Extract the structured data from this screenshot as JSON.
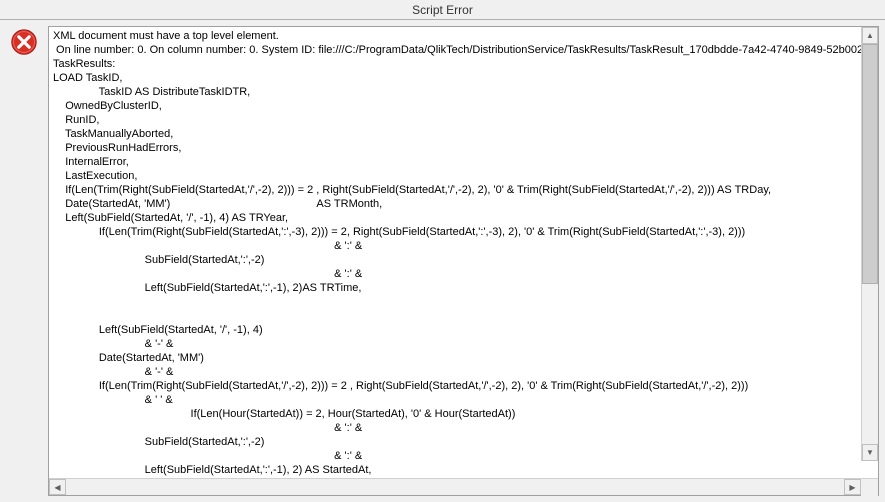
{
  "window": {
    "title": "Script Error"
  },
  "error": {
    "text": "XML document must have a top level element.\n On line number: 0. On column number: 0. System ID: file:///C:/ProgramData/QlikTech/DistributionService/TaskResults/TaskResult_170dbdde-7a42-4740-9849-52b002\nTaskResults:\nLOAD TaskID,\n               TaskID AS DistributeTaskIDTR,\n    OwnedByClusterID,\n    RunID,\n    TaskManuallyAborted,\n    PreviousRunHadErrors,\n    InternalError,\n    LastExecution,\n    If(Len(Trim(Right(SubField(StartedAt,'/',-2), 2))) = 2 , Right(SubField(StartedAt,'/',-2), 2), '0' & Trim(Right(SubField(StartedAt,'/',-2), 2))) AS TRDay,\n    Date(StartedAt, 'MM')                                                AS TRMonth,\n    Left(SubField(StartedAt, '/', -1), 4) AS TRYear,\n               If(Len(Trim(Right(SubField(StartedAt,':',-3), 2))) = 2, Right(SubField(StartedAt,':',-3), 2), '0' & Trim(Right(SubField(StartedAt,':',-3), 2)))\n                                                                                            & ':' &\n                              SubField(StartedAt,':',-2)\n                                                                                            & ':' &\n                              Left(SubField(StartedAt,':',-1), 2)AS TRTime,\n\n\n               Left(SubField(StartedAt, '/', -1), 4)\n                              & '-' &\n               Date(StartedAt, 'MM')\n                              & '-' &\n               If(Len(Trim(Right(SubField(StartedAt,'/',-2), 2))) = 2 , Right(SubField(StartedAt,'/',-2), 2), '0' & Trim(Right(SubField(StartedAt,'/',-2), 2)))\n                              & ' ' &\n                                             If(Len(Hour(StartedAt)) = 2, Hour(StartedAt), '0' & Hour(StartedAt))\n                                                                                            & ':' &\n                              SubField(StartedAt,':',-2)\n                                                                                            & ':' &\n                              Left(SubField(StartedAt,':',-1), 2) AS StartedAt,"
  },
  "icons": {
    "error": "error-icon"
  }
}
